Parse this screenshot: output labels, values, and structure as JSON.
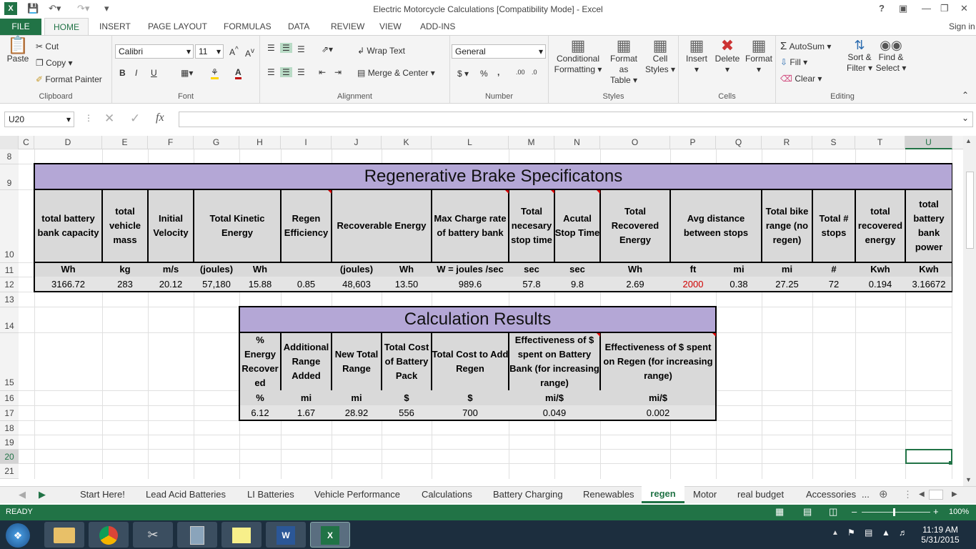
{
  "window": {
    "title": "Electric Motorcycle Calculations  [Compatibility Mode] - Excel",
    "sign_in": "Sign in",
    "help": "?"
  },
  "ribbon_tabs": [
    "FILE",
    "HOME",
    "INSERT",
    "PAGE LAYOUT",
    "FORMULAS",
    "DATA",
    "REVIEW",
    "VIEW",
    "ADD-INS"
  ],
  "clipboard": {
    "paste": "Paste",
    "cut": "Cut",
    "copy": "Copy",
    "format_painter": "Format Painter",
    "label": "Clipboard"
  },
  "font": {
    "name": "Calibri",
    "size": "11",
    "label": "Font",
    "bold": "B",
    "italic": "I",
    "underline": "U"
  },
  "alignment": {
    "wrap": "Wrap Text",
    "merge": "Merge & Center",
    "label": "Alignment"
  },
  "number": {
    "format": "General",
    "currency": "$",
    "percent": "%",
    "comma": ",",
    "label": "Number"
  },
  "styles": {
    "conditional": [
      "Conditional",
      "Formatting"
    ],
    "format_table": [
      "Format as",
      "Table"
    ],
    "cell_styles": [
      "Cell",
      "Styles"
    ],
    "label": "Styles"
  },
  "cells": {
    "insert": "Insert",
    "delete": "Delete",
    "format": "Format",
    "label": "Cells"
  },
  "editing": {
    "autosum": "AutoSum",
    "fill": "Fill",
    "clear": "Clear",
    "sort": [
      "Sort &",
      "Filter"
    ],
    "find": [
      "Find &",
      "Select"
    ],
    "label": "Editing"
  },
  "formula_bar": {
    "name_box": "U20",
    "fx": "fx",
    "value": ""
  },
  "columns": [
    "C",
    "D",
    "E",
    "F",
    "G",
    "H",
    "I",
    "J",
    "K",
    "L",
    "M",
    "N",
    "O",
    "P",
    "Q",
    "R",
    "S",
    "T",
    "U"
  ],
  "rows": [
    "8",
    "9",
    "10",
    "11",
    "12",
    "13",
    "14",
    "15",
    "16",
    "17",
    "18",
    "19",
    "20",
    "21"
  ],
  "regen": {
    "title": "Regenerative Brake Specificatons",
    "headers": [
      "total battery bank capacity",
      "total vehicle mass",
      "Initial Velocity",
      "Total Kinetic Energy",
      "Regen Efficiency",
      "Recoverable Energy",
      "Max Charge rate of battery bank",
      "Total necesary stop time",
      "Acutal Stop Time",
      "Total Recovered Energy",
      "Avg distance between stops",
      "Total bike range (no regen)",
      "Total # stops",
      "total recovered energy",
      "total battery bank power"
    ],
    "units": [
      "Wh",
      "kg",
      "m/s",
      "(joules)",
      "Wh",
      "",
      "(joules)",
      "Wh",
      "W = joules /sec",
      "sec",
      "sec",
      "Wh",
      "ft",
      "mi",
      "mi",
      "#",
      "Kwh",
      "Kwh"
    ],
    "values": [
      "3166.72",
      "283",
      "20.12",
      "57,180",
      "15.88",
      "0.85",
      "48,603",
      "13.50",
      "989.6",
      "57.8",
      "9.8",
      "2.69",
      "2000",
      "0.38",
      "27.25",
      "72",
      "0.194",
      "3.16672"
    ],
    "highlight_color": "#d00000"
  },
  "results": {
    "title": "Calculation Results",
    "headers": [
      "% Energy Recover ed",
      "Additional Range Added",
      "New Total Range",
      "Total Cost of Battery Pack",
      "Total Cost to Add Regen",
      "Effectiveness of $ spent on Battery Bank (for increasing range)",
      "Effectiveness of $ spent on Regen (for increasing range)"
    ],
    "units": [
      "%",
      "mi",
      "mi",
      "$",
      "$",
      "mi/$",
      "mi/$"
    ],
    "values": [
      "6.12",
      "1.67",
      "28.92",
      "556",
      "700",
      "0.049",
      "0.002"
    ]
  },
  "sheet_tabs": [
    "Start Here!",
    "Lead Acid Batteries",
    "LI Batteries",
    "Vehicle Performance",
    "Calculations",
    "Battery Charging",
    "Renewables",
    "regen",
    "Motor",
    "real budget",
    "Accessories",
    "..."
  ],
  "active_sheet": "regen",
  "status": {
    "ready": "READY",
    "zoom": "100%"
  },
  "clock": {
    "time": "11:19 AM",
    "date": "5/31/2015"
  },
  "colors": {
    "excel_green": "#217346",
    "header_purple": "#b4a7d6",
    "band_gray": "#d9d9d9"
  }
}
